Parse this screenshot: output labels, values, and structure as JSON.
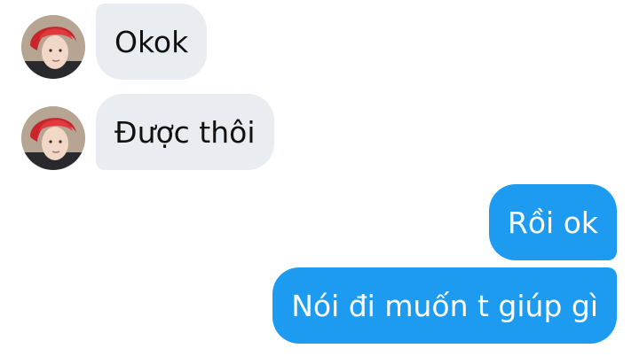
{
  "conversation": {
    "messages": [
      {
        "sender": "contact",
        "text": "Okok"
      },
      {
        "sender": "contact",
        "text": "Được thôi"
      },
      {
        "sender": "self",
        "text": "Rồi ok"
      },
      {
        "sender": "self",
        "text": "Nói đi muốn t giúp gì"
      }
    ]
  },
  "colors": {
    "incoming_bubble": "#e9edf1",
    "outgoing_bubble": "#1d9bf0",
    "outgoing_text": "#ffffff",
    "incoming_text": "#111111"
  }
}
